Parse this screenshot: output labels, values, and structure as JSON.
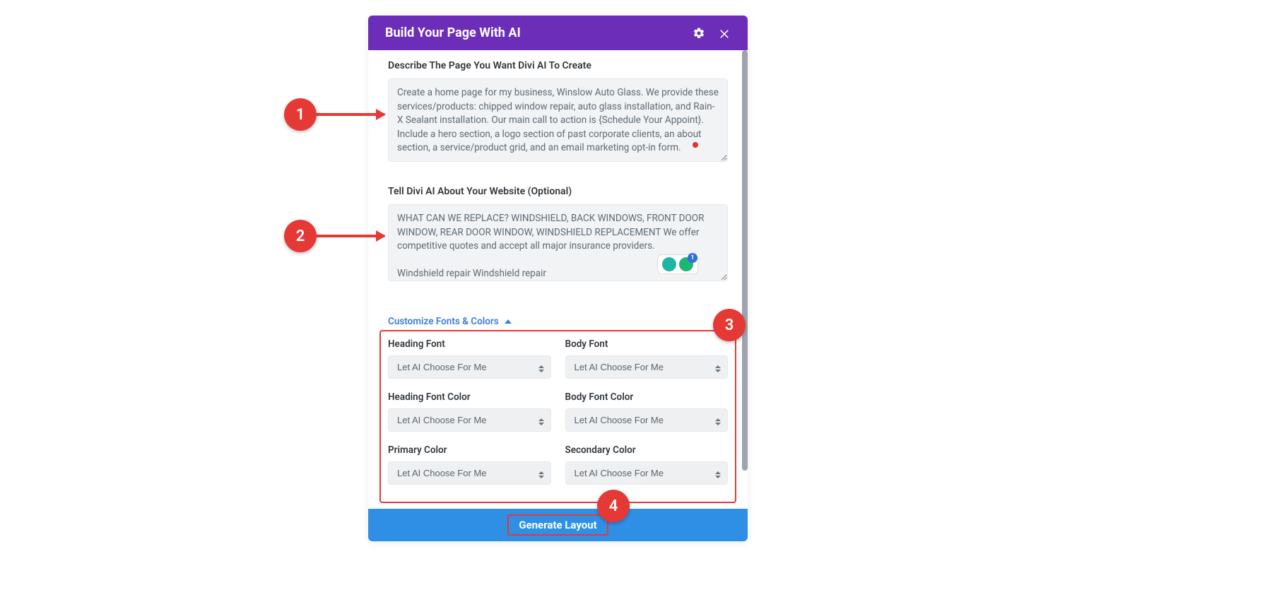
{
  "modal": {
    "title": "Build Your Page With AI",
    "icons": {
      "settings": "gear-icon",
      "close": "close-icon"
    }
  },
  "fields": {
    "describe": {
      "label": "Describe The Page You Want Divi AI To Create",
      "value": "Create a home page for my business, Winslow Auto Glass. We provide these services/products: chipped window repair, auto glass installation, and Rain-X Sealant installation. Our main call to action is {Schedule Your Appoint}. Include a hero section, a logo section of past corporate clients, an about section, a service/product grid, and an email marketing opt-in form."
    },
    "website": {
      "label": "Tell Divi AI About Your Website (Optional)",
      "value": "WHAT CAN WE REPLACE? WINDSHIELD, BACK WINDOWS, FRONT DOOR WINDOW, REAR DOOR WINDOW, WINDSHIELD REPLACEMENT We offer competitive quotes and accept all major insurance providers.\n\nWindshield repair Windshield repair"
    },
    "customize_link": "Customize Fonts & Colors",
    "selects": {
      "heading_font": {
        "label": "Heading Font",
        "value": "Let AI Choose For Me"
      },
      "body_font": {
        "label": "Body Font",
        "value": "Let AI Choose For Me"
      },
      "heading_font_color": {
        "label": "Heading Font Color",
        "value": "Let AI Choose For Me"
      },
      "body_font_color": {
        "label": "Body Font Color",
        "value": "Let AI Choose For Me"
      },
      "primary_color": {
        "label": "Primary Color",
        "value": "Let AI Choose For Me"
      },
      "secondary_color": {
        "label": "Secondary Color",
        "value": "Let AI Choose For Me"
      }
    }
  },
  "generate_button": "Generate Layout",
  "annotations": {
    "1": "1",
    "2": "2",
    "3": "3",
    "4": "4"
  },
  "grammarly_count": "1",
  "colors": {
    "header_bg": "#6c2eb9",
    "link_blue": "#3b7dd8",
    "generate_bg": "#2f8fe5",
    "annotation_red": "#e53935"
  }
}
